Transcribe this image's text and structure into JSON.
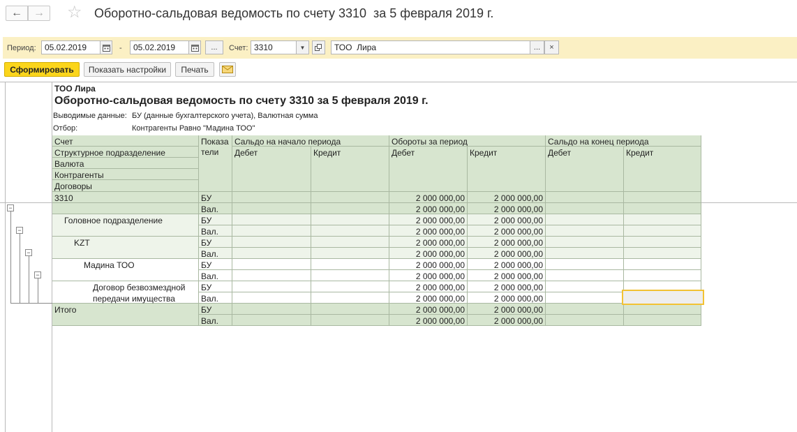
{
  "window": {
    "title": "Оборотно-сальдовая ведомость по счету 3310  за 5 февраля 2019 г.",
    "back_icon": "←",
    "forward_icon": "→",
    "star_icon": "☆"
  },
  "params": {
    "period_label": "Период:",
    "date_from": "05.02.2019",
    "dash": "-",
    "date_to": "05.02.2019",
    "ellipsis": "...",
    "account_label": "Счет:",
    "account": "3310",
    "org": "ТОО  Лира",
    "org_ellipsis": "...",
    "clear": "×"
  },
  "buttons": {
    "generate": "Сформировать",
    "settings": "Показать настройки",
    "print": "Печать"
  },
  "report": {
    "org": "ТОО  Лира",
    "title": "Оборотно-сальдовая ведомость по счету 3310  за 5 февраля 2019 г.",
    "output_label": "Выводимые данные:",
    "output_value": "БУ (данные бухгалтерского учета), Валютная сумма",
    "filter_label": "Отбор:",
    "filter_value": "Контрагенты Равно \"Мадина ТОО\"",
    "head": {
      "schet": "Счет",
      "struct": "Структурное подразделение",
      "valuta": "Валюта",
      "kontr": "Контрагенты",
      "dogovory": "Договоры",
      "pokaz1": "Показа",
      "pokaz2": "тели",
      "start": "Сальдо на начало периода",
      "turnover": "Обороты за период",
      "end": "Сальдо на конец периода",
      "debit": "Дебет",
      "credit": "Кредит"
    },
    "rows": {
      "acc": "3310",
      "div": "Головное подразделение",
      "cur": "KZT",
      "cp": "Мадина ТОО",
      "contract1": "Договор безвозмездной",
      "contract2": "передачи имущества",
      "total": "Итого",
      "bu": "БУ",
      "val": "Вал.",
      "amount": "2 000 000,00"
    }
  },
  "colors": {
    "band": "#fbf0c4",
    "header_green": "#d7e5cf",
    "row_light": "#eef4ea",
    "primary": "#fbd51b",
    "selection": "#f2c233"
  }
}
